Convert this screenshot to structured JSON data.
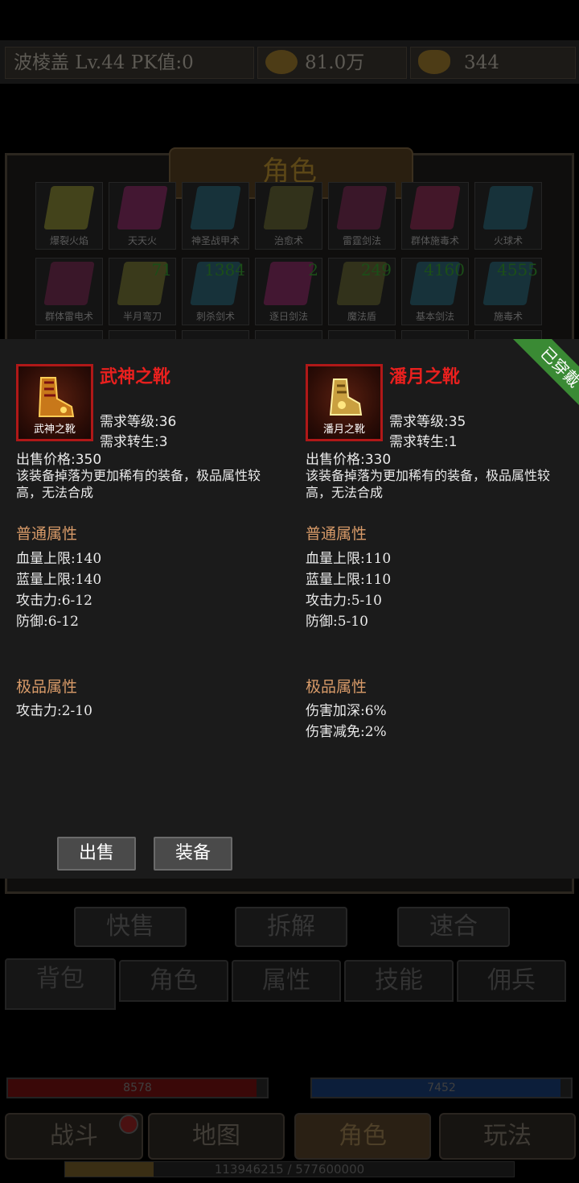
{
  "player": {
    "info": "波棱盖 Lv.44 PK值:0",
    "gold": "81.0万",
    "ingot": "344"
  },
  "panel": {
    "title": "角色"
  },
  "skills_row1": [
    {
      "name": "爆裂火焰",
      "color": "#6a6a20"
    },
    {
      "name": "天天火",
      "color": "#6a1a4a"
    },
    {
      "name": "神圣战甲术",
      "color": "#1a4a5a"
    },
    {
      "name": "治愈术",
      "color": "#4a4a20"
    },
    {
      "name": "雷霆剑法",
      "color": "#5a1a3a"
    },
    {
      "name": "群体施毒术",
      "color": "#6a1a3a"
    },
    {
      "name": "火球术",
      "color": "#1a4a5a"
    }
  ],
  "skills_row2": [
    {
      "name": "群体雷电术",
      "color": "#5a1a3a",
      "num": ""
    },
    {
      "name": "半月弯刀",
      "color": "#5a5a20",
      "num": "71"
    },
    {
      "name": "刺杀剑术",
      "color": "#1a4a5a",
      "num": "1384"
    },
    {
      "name": "逐日剑法",
      "color": "#6a1a4a",
      "num": "2"
    },
    {
      "name": "魔法盾",
      "color": "#4a4a20",
      "num": "249"
    },
    {
      "name": "基本剑法",
      "color": "#1a4a5a",
      "num": "4160"
    },
    {
      "name": "施毒术",
      "color": "#1a4a5a",
      "num": "4555"
    }
  ],
  "actions_dim": [
    "快售",
    "拆解",
    "速合"
  ],
  "tabs": [
    "背包",
    "角色",
    "属性",
    "技能",
    "佣兵"
  ],
  "hp": "8578",
  "mp": "7452",
  "nav": [
    "战斗",
    "地图",
    "角色",
    "玩法"
  ],
  "exp": {
    "text": "113946215 / 577600000",
    "fraction": 0.197
  },
  "left_item": {
    "name": "武神之靴",
    "icon_caption": "武神之靴",
    "req_level": "需求等级:36",
    "req_rebirth": "需求转生:3",
    "price": "出售价格:350",
    "desc": "该装备掉落为更加稀有的装备，极品属性较高，无法合成",
    "normal_title": "普通属性",
    "normal": [
      "血量上限:140",
      "蓝量上限:140",
      "攻击力:6-12",
      "防御:6-12"
    ],
    "special_title": "极品属性",
    "special": [
      "攻击力:2-10"
    ]
  },
  "right_item": {
    "name": "潘月之靴",
    "icon_caption": "潘月之靴",
    "req_level": "需求等级:35",
    "req_rebirth": "需求转生:1",
    "price": "出售价格:330",
    "desc": "该装备掉落为更加稀有的装备，极品属性较高，无法合成",
    "normal_title": "普通属性",
    "normal": [
      "血量上限:110",
      "蓝量上限:110",
      "攻击力:5-10",
      "防御:5-10"
    ],
    "special_title": "极品属性",
    "special": [
      "伤害加深:6%",
      "伤害减免:2%"
    ],
    "badge": "已穿戴"
  },
  "buttons": {
    "sell": "出售",
    "equip": "装备"
  }
}
